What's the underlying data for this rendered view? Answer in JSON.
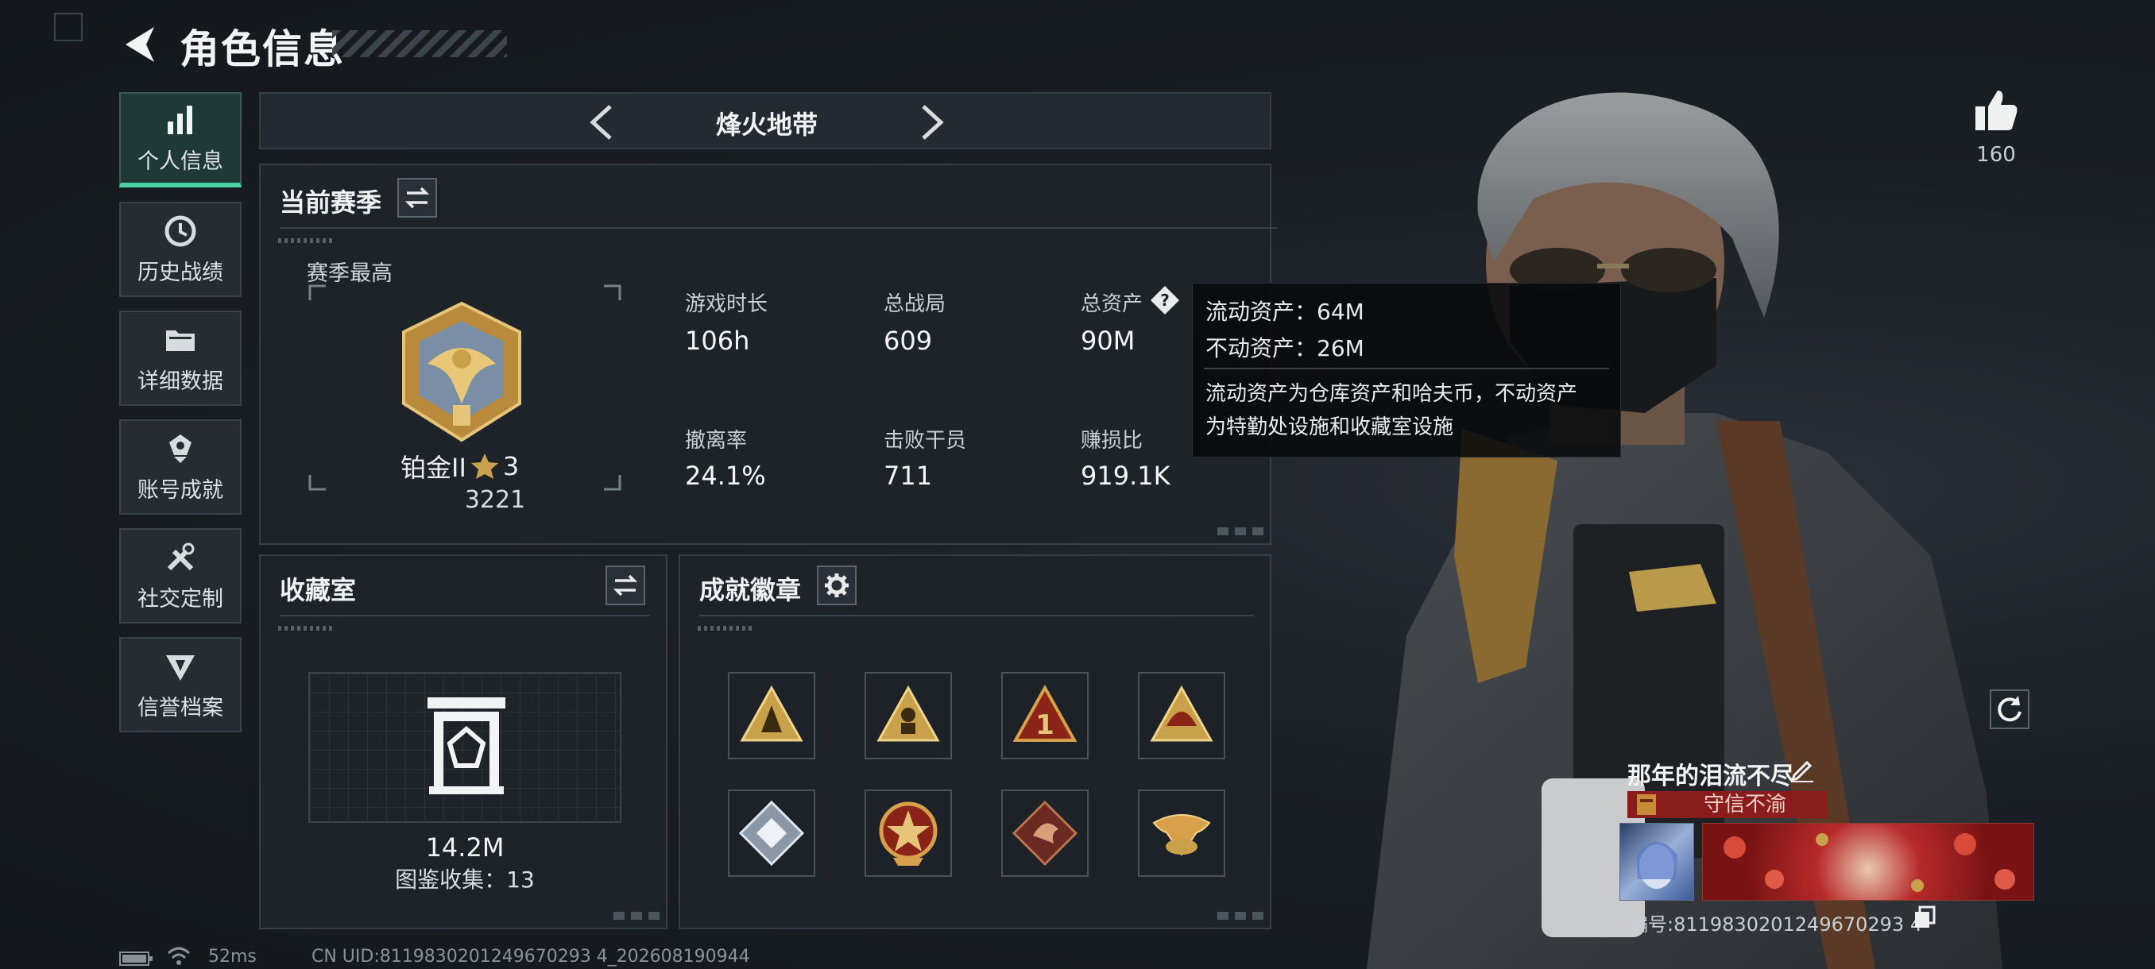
{
  "header": {
    "title": "角色信息"
  },
  "sidebar": {
    "items": [
      {
        "label": "个人信息",
        "icon": "bar-chart-icon",
        "active": true
      },
      {
        "label": "历史战绩",
        "icon": "clock-icon"
      },
      {
        "label": "详细数据",
        "icon": "folder-icon"
      },
      {
        "label": "账号成就",
        "icon": "medal-icon"
      },
      {
        "label": "社交定制",
        "icon": "tools-icon"
      },
      {
        "label": "信誉档案",
        "icon": "shield-icon"
      }
    ]
  },
  "mode": {
    "title": "烽火地带"
  },
  "season": {
    "title": "当前赛季",
    "best_label": "赛季最高",
    "rank_name": "铂金II",
    "rank_stars": "3",
    "rank_score": "3221",
    "stats": [
      {
        "label": "游戏时长",
        "value": "106h"
      },
      {
        "label": "总战局",
        "value": "609"
      },
      {
        "label": "总资产",
        "value": "90M"
      },
      {
        "label": "撤离率",
        "value": "24.1%"
      },
      {
        "label": "击败干员",
        "value": "711"
      },
      {
        "label": "赚损比",
        "value": "919.1K"
      }
    ]
  },
  "tooltip": {
    "line1": "流动资产：64M",
    "line2": "不动资产：26M",
    "desc1": "流动资产为仓库资产和哈夫币，不动资产",
    "desc2": "为特勤处设施和收藏室设施"
  },
  "collection": {
    "title": "收藏室",
    "value": "14.2M",
    "count_label": "图鉴收集：13"
  },
  "badges": {
    "title": "成就徽章",
    "items": [
      "survivor-badge-icon",
      "soldier-badge-icon",
      "number-one-badge-icon",
      "helmet-badge-icon",
      "silver-badge-icon",
      "star-medal-badge-icon",
      "dragon-badge-icon",
      "eagle-badge-icon"
    ]
  },
  "likes": {
    "count": "160"
  },
  "player": {
    "name": "那年的泪流不尽",
    "title_badge": "守信不渝",
    "id_label": "编号:8119830201249670293 4"
  },
  "status": {
    "ping": "52ms",
    "uid": "CN UID:8119830201249670293 4_202608190944"
  },
  "colors": {
    "accent": "#4bd4a3",
    "gold": "#c9a14a",
    "tooltip_bg": "#08090c",
    "title_badge_bg": "#8a1c1c"
  }
}
